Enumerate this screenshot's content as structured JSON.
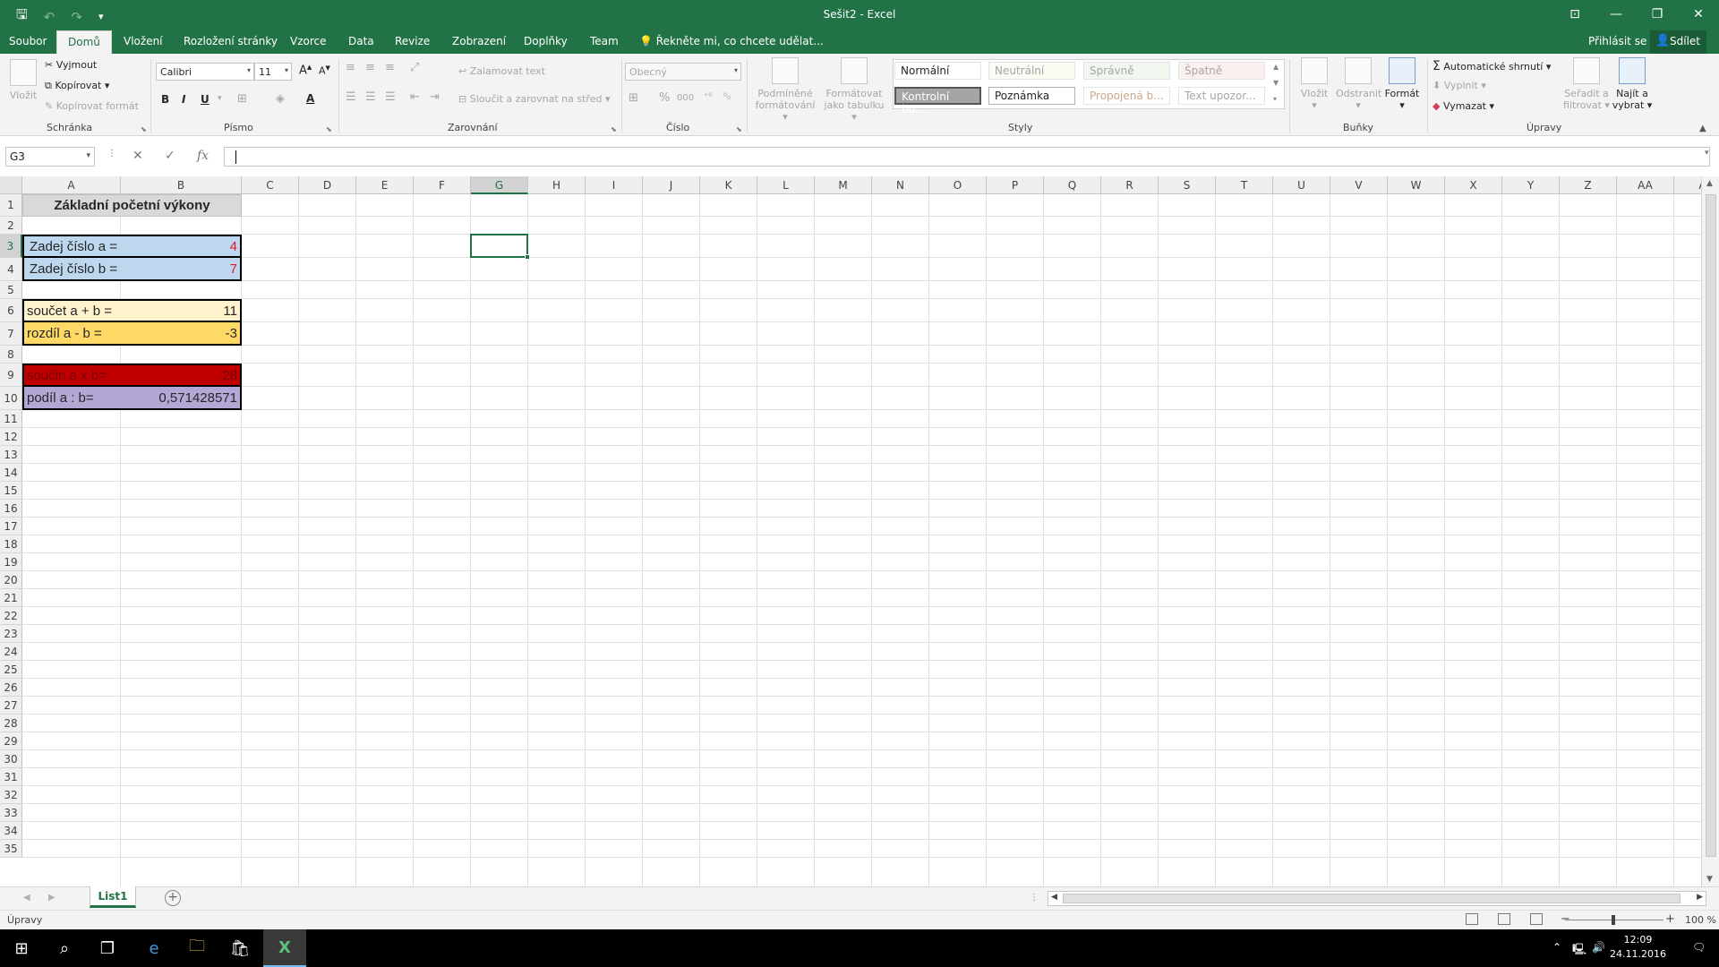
{
  "titlebar": {
    "title": "Sešit2 - Excel",
    "qat": [
      "save-icon",
      "undo-icon",
      "redo-icon",
      "customize-icon"
    ]
  },
  "tabs": {
    "file": "Soubor",
    "home": "Domů",
    "insert": "Vložení",
    "layout": "Rozložení stránky",
    "formulas": "Vzorce",
    "data": "Data",
    "review": "Revize",
    "view": "Zobrazení",
    "addins": "Doplňky",
    "team": "Team",
    "tellme": "Řekněte mi, co chcete udělat...",
    "signin": "Přihlásit se",
    "share": "Sdílet"
  },
  "ribbon": {
    "clipboard": {
      "label": "Schránka",
      "paste": "Vložit",
      "cut": "Vyjmout",
      "copy": "Kopírovat",
      "painter": "Kopírovat formát"
    },
    "font": {
      "label": "Písmo",
      "name": "Calibri",
      "size": "11",
      "bold": "B",
      "italic": "I",
      "underline": "U",
      "fontcolor": "A"
    },
    "alignment": {
      "label": "Zarovnání",
      "wrap": "Zalamovat text",
      "merge": "Sloučit a zarovnat na střed"
    },
    "number": {
      "label": "Číslo",
      "format": "Obecný",
      "percent": "%",
      "thousands": "000"
    },
    "styles": {
      "label": "Styly",
      "cond1": "Podmíněné",
      "cond2": "formátování",
      "table1": "Formátovat",
      "table2": "jako tabulku",
      "normal": "Normální",
      "neutral": "Neutrální",
      "good": "Správně",
      "bad": "Špatně",
      "check": "Kontrolní bu...",
      "note": "Poznámka",
      "linked": "Propojená b...",
      "warning": "Text upozor..."
    },
    "cells": {
      "label": "Buňky",
      "insert": "Vložit",
      "delete": "Odstranit",
      "format": "Formát"
    },
    "editing": {
      "label": "Úpravy",
      "autosum": "Automatické shrnutí",
      "fill": "Vyplnit",
      "clear": "Vymazat",
      "sort1": "Seřadit a",
      "sort2": "filtrovat",
      "find1": "Najít a",
      "find2": "vybrat"
    }
  },
  "formula_bar": {
    "namebox": "G3",
    "cancel": "✕",
    "enter": "✓",
    "fx": "fx",
    "content": ""
  },
  "columns": [
    "A",
    "B",
    "C",
    "D",
    "E",
    "F",
    "G",
    "H",
    "I",
    "J",
    "K",
    "L",
    "M",
    "N",
    "O",
    "P",
    "Q",
    "R",
    "S",
    "T",
    "U",
    "V",
    "W",
    "X",
    "Y",
    "Z",
    "AA",
    "A"
  ],
  "rows": [
    "1",
    "2",
    "3",
    "4",
    "5",
    "6",
    "7",
    "8",
    "9",
    "10",
    "11",
    "12",
    "13",
    "14",
    "15",
    "16",
    "17",
    "18",
    "19",
    "20",
    "21",
    "22",
    "23",
    "24",
    "25",
    "26",
    "27",
    "28",
    "29",
    "30",
    "31",
    "32",
    "33",
    "34",
    "35"
  ],
  "cells": {
    "A1": "Základní početní výkony",
    "A3": "Zadej číslo a =",
    "B3": "4",
    "A4": "Zadej číslo b =",
    "B4": "7",
    "A6": "součet a + b =",
    "B6": "11",
    "A7": "rozdíl a - b =",
    "B7": "-3",
    "A9": "součin a x b=",
    "B9": "28",
    "A10": "podíl a : b=",
    "B10": "0,571428571"
  },
  "cell_colors": {
    "title_bg": "#d9d9d9",
    "input_bg": "#bdd7ee",
    "input_value": "#e0182d",
    "sum_bg": "#fff2cc",
    "diff_bg": "#ffd966",
    "product_bg": "#c00000",
    "quotient_bg": "#b4a7d6"
  },
  "sheets": {
    "active": "List1",
    "add": "+"
  },
  "status": {
    "mode": "Úpravy",
    "zoom": "100 %"
  },
  "taskbar": {
    "time": "12:09",
    "date": "24.11.2016"
  }
}
